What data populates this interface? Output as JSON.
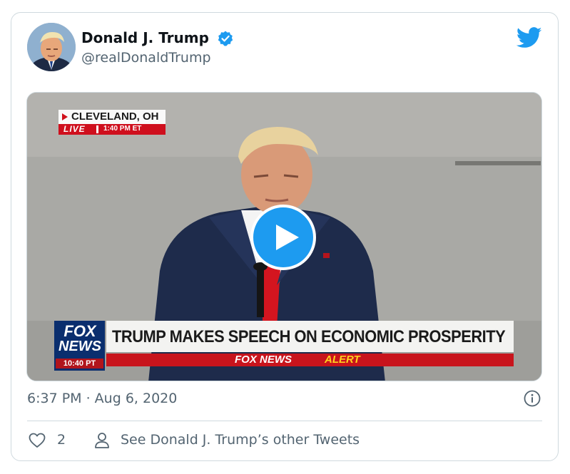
{
  "tweet": {
    "author": {
      "name": "Donald J. Trump",
      "handle": "@realDonaldTrump",
      "verified": true,
      "avatar": "profile-photo"
    },
    "brand_icon": "twitter-bird-icon",
    "media": {
      "type": "video",
      "play_icon": "play-icon",
      "overlay": {
        "location": "CLEVELAND, OH",
        "live_label": "LIVE",
        "live_time": "1:40 PM ET",
        "logo_fox": "FOX",
        "logo_news": "NEWS",
        "logo_time": "10:40 PT",
        "headline": "TRUMP MAKES SPEECH ON ECONOMIC PROSPERITY",
        "alert_brand": "FOX NEWS",
        "alert_word": "ALERT"
      }
    },
    "timestamp": "6:37 PM · Aug 6, 2020",
    "info_icon": "info-icon",
    "actions": {
      "like_count": "2",
      "other_tweets_label": "See Donald J. Trump’s other Tweets"
    },
    "colors": {
      "accent": "#1d9bf0",
      "text_secondary": "#536471",
      "fox_red": "#c8141c",
      "fox_blue": "#0a2e6e"
    }
  }
}
